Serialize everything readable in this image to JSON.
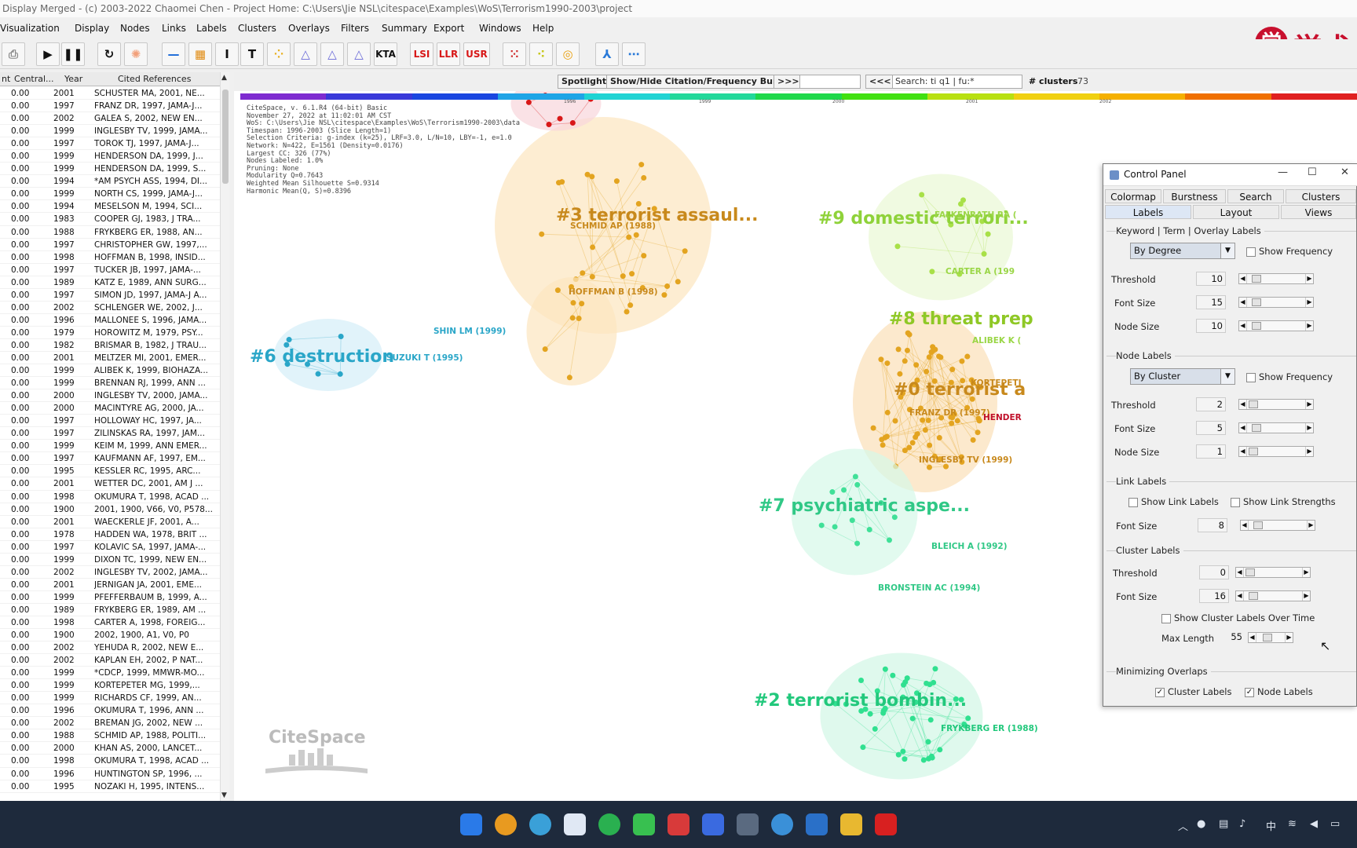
{
  "window": {
    "title": "Display Merged - (c) 2003-2022 Chaomei Chen - Project Home: C:\\Users\\Jie NSL\\citespace\\Examples\\WoS\\Terrorism1990-2003\\project"
  },
  "menu": [
    "Visualization",
    "Display",
    "Nodes",
    "Links",
    "Labels",
    "Clusters",
    "Overlays",
    "Filters",
    "Summary",
    "Export",
    "Windows",
    "Help"
  ],
  "brand": {
    "seal": "学",
    "text": "学术"
  },
  "toolbar": {
    "kta": "KTA",
    "lsi": "LSI",
    "llr": "LLR",
    "usr": "USR"
  },
  "table": {
    "headers": [
      "nt",
      "Central...",
      "Year",
      "Cited References"
    ],
    "rows": [
      [
        "0.00",
        "2001",
        "SCHUSTER MA, 2001, NE..."
      ],
      [
        "0.00",
        "1997",
        "FRANZ DR, 1997, JAMA-J..."
      ],
      [
        "0.00",
        "2002",
        "GALEA S, 2002, NEW EN..."
      ],
      [
        "0.00",
        "1999",
        "INGLESBY TV, 1999, JAMA..."
      ],
      [
        "0.00",
        "1997",
        "TOROK TJ, 1997, JAMA-J..."
      ],
      [
        "0.00",
        "1999",
        "HENDERSON DA, 1999, J..."
      ],
      [
        "0.00",
        "1999",
        "HENDERSON DA, 1999, S..."
      ],
      [
        "0.00",
        "1994",
        "*AM PSYCH ASS, 1994, DI..."
      ],
      [
        "0.00",
        "1999",
        "NORTH CS, 1999, JAMA-J..."
      ],
      [
        "0.00",
        "1994",
        "MESELSON M, 1994, SCI..."
      ],
      [
        "0.00",
        "1983",
        "COOPER GJ, 1983, J TRA..."
      ],
      [
        "0.00",
        "1988",
        "FRYKBERG ER, 1988, AN..."
      ],
      [
        "0.00",
        "1997",
        "CHRISTOPHER GW, 1997,..."
      ],
      [
        "0.00",
        "1998",
        "HOFFMAN B, 1998, INSID..."
      ],
      [
        "0.00",
        "1997",
        "TUCKER JB, 1997, JAMA-..."
      ],
      [
        "0.00",
        "1989",
        "KATZ E, 1989, ANN SURG..."
      ],
      [
        "0.00",
        "1997",
        "SIMON JD, 1997, JAMA-J A..."
      ],
      [
        "0.00",
        "2002",
        "SCHLENGER WE, 2002, J..."
      ],
      [
        "0.00",
        "1996",
        "MALLONEE S, 1996, JAMA..."
      ],
      [
        "0.00",
        "1979",
        "HOROWITZ M, 1979, PSY..."
      ],
      [
        "0.00",
        "1982",
        "BRISMAR B, 1982, J TRAU..."
      ],
      [
        "0.00",
        "2001",
        "MELTZER MI, 2001, EMER..."
      ],
      [
        "0.00",
        "1999",
        "ALIBEK K, 1999, BIOHAZA..."
      ],
      [
        "0.00",
        "1999",
        "BRENNAN RJ, 1999, ANN ..."
      ],
      [
        "0.00",
        "2000",
        "INGLESBY TV, 2000, JAMA..."
      ],
      [
        "0.00",
        "2000",
        "MACINTYRE AG, 2000, JA..."
      ],
      [
        "0.00",
        "1997",
        "HOLLOWAY HC, 1997, JA..."
      ],
      [
        "0.00",
        "1997",
        "ZILINSKAS RA, 1997, JAM..."
      ],
      [
        "0.00",
        "1999",
        "KEIM M, 1999, ANN EMER..."
      ],
      [
        "0.00",
        "1997",
        "KAUFMANN AF, 1997, EM..."
      ],
      [
        "0.00",
        "1995",
        "KESSLER RC, 1995, ARC..."
      ],
      [
        "0.00",
        "2001",
        "WETTER DC, 2001, AM J ..."
      ],
      [
        "0.00",
        "1998",
        "OKUMURA T, 1998, ACAD ..."
      ],
      [
        "0.00",
        "1900",
        "2001, 1900, V66, V0, P578..."
      ],
      [
        "0.00",
        "2001",
        "WAECKERLE JF, 2001, A..."
      ],
      [
        "0.00",
        "1978",
        "HADDEN WA, 1978, BRIT ..."
      ],
      [
        "0.00",
        "1997",
        "KOLAVIC SA, 1997, JAMA-..."
      ],
      [
        "0.00",
        "1999",
        "DIXON TC, 1999, NEW EN..."
      ],
      [
        "0.00",
        "2002",
        "INGLESBY TV, 2002, JAMA..."
      ],
      [
        "0.00",
        "2001",
        "JERNIGAN JA, 2001, EME..."
      ],
      [
        "0.00",
        "1999",
        "PFEFFERBAUM B, 1999, A..."
      ],
      [
        "0.00",
        "1989",
        "FRYKBERG ER, 1989, AM ..."
      ],
      [
        "0.00",
        "1998",
        "CARTER A, 1998, FOREIG..."
      ],
      [
        "0.00",
        "1900",
        "2002, 1900, A1, V0, P0"
      ],
      [
        "0.00",
        "2002",
        "YEHUDA R, 2002, NEW E..."
      ],
      [
        "0.00",
        "2002",
        "KAPLAN EH, 2002, P NAT..."
      ],
      [
        "0.00",
        "1999",
        "*CDCP, 1999, MMWR-MO..."
      ],
      [
        "0.00",
        "1999",
        "KORTEPETER MG, 1999,..."
      ],
      [
        "0.00",
        "1999",
        "RICHARDS CF, 1999, AN..."
      ],
      [
        "0.00",
        "1996",
        "OKUMURA T, 1996, ANN ..."
      ],
      [
        "0.00",
        "2002",
        "BREMAN JG, 2002, NEW ..."
      ],
      [
        "0.00",
        "1988",
        "SCHMID AP, 1988, POLITI..."
      ],
      [
        "0.00",
        "2000",
        "KHAN AS, 2000, LANCET..."
      ],
      [
        "0.00",
        "1998",
        "OKUMURA T, 1998, ACAD ..."
      ],
      [
        "0.00",
        "1996",
        "HUNTINGTON SP, 1996, ..."
      ],
      [
        "0.00",
        "1995",
        "NOZAKI H, 1995, INTENS..."
      ]
    ]
  },
  "vis_toolbar": {
    "spotlight": "Spotlight",
    "burst": "Show/Hide Citation/Frequency Burst",
    "next": ">>>",
    "prev": "<<<",
    "search": "Search: ti q1 | fu:*",
    "clusters_label": "# clusters",
    "clusters_value": "73"
  },
  "timeline": {
    "colors": [
      "#7e2bd0",
      "#3939d9",
      "#1a47e0",
      "#20a4e6",
      "#20d3d3",
      "#22d89a",
      "#1ed84a",
      "#40e010",
      "#b8e010",
      "#f0d010",
      "#f5b000",
      "#f07000",
      "#e02020"
    ],
    "years": [
      "1996",
      "1999",
      "2000",
      "2001",
      "2002"
    ]
  },
  "info_lines": [
    "CiteSpace, v. 6.1.R4 (64-bit) Basic",
    "November 27, 2022 at 11:02:01 AM CST",
    "WoS: C:\\Users\\Jie NSL\\citespace\\Examples\\WoS\\Terrorism1990-2003\\data",
    "Timespan: 1996-2003 (Slice Length=1)",
    "Selection Criteria: g-index (k=25), LRF=3.0, L/N=10, LBY=-1, e=1.0",
    "Network: N=422, E=1561 (Density=0.0176)",
    "Largest CC: 326 (77%)",
    "Nodes Labeled: 1.0%",
    "Pruning: None",
    "Modularity Q=0.7643",
    "Weighted Mean Silhouette S=0.9314",
    "Harmonic Mean(Q, S)=0.8396"
  ],
  "clusters": [
    {
      "label": "#3 terrorist assaul...",
      "color": "#c8891c"
    },
    {
      "label": "#9 domestic terrori...",
      "color": "#8fd23a"
    },
    {
      "label": "#8 threat prep",
      "color": "#8fc826"
    },
    {
      "label": "#0 terrorist a",
      "color": "#c8891c"
    },
    {
      "label": "#6 destruction",
      "color": "#2aa6c8"
    },
    {
      "label": "#7 psychiatric aspe...",
      "color": "#30c886"
    },
    {
      "label": "#2 terrorist bombin...",
      "color": "#22c87c"
    }
  ],
  "node_labels": [
    {
      "label": "SCHMID AP (1988)",
      "color": "#c8891c"
    },
    {
      "label": "HOFFMAN B (1998)",
      "color": "#c8891c"
    },
    {
      "label": "SHIN LM (1999)",
      "color": "#2aa6c8"
    },
    {
      "label": "ISUZUKI T (1995)",
      "color": "#2aa6c8"
    },
    {
      "label": "FALKENRATH RA (",
      "color": "#9ad646"
    },
    {
      "label": "CARTER A (199",
      "color": "#9ad646"
    },
    {
      "label": "ALIBEK K (",
      "color": "#9ad646"
    },
    {
      "label": "KORTEPETI",
      "color": "#c8891c"
    },
    {
      "label": "FRANZ DR (1997)",
      "color": "#c8891c"
    },
    {
      "label": "HENDER",
      "color": "#c0102a"
    },
    {
      "label": "INGLESBY TV (1999)",
      "color": "#c8891c"
    },
    {
      "label": "BLEICH A (1992)",
      "color": "#30c886"
    },
    {
      "label": "BRONSTEIN AC (1994)",
      "color": "#30c886"
    },
    {
      "label": "FRYKBERG ER (1988)",
      "color": "#22c87c"
    }
  ],
  "citespace_logo": "CiteSpace",
  "control_panel": {
    "title": "Control Panel",
    "tabs_top": [
      "Colormap",
      "Burstness",
      "Search",
      "Clusters"
    ],
    "tabs_bottom": [
      "Labels",
      "Layout",
      "Views"
    ],
    "keyword_section": "Keyword | Term | Overlay Labels",
    "keyword_combo": "By Degree",
    "node_section": "Node Labels",
    "node_combo": "By Cluster",
    "show_frequency": "Show Frequency",
    "threshold": "Threshold",
    "font_size": "Font Size",
    "node_size": "Node Size",
    "kw_threshold": "10",
    "kw_font": "15",
    "kw_node": "10",
    "nl_threshold": "2",
    "nl_font": "5",
    "nl_node": "1",
    "link_section": "Link Labels",
    "show_link_labels": "Show Link Labels",
    "show_link_strengths": "Show Link Strengths",
    "link_font": "8",
    "cluster_section": "Cluster Labels",
    "cl_threshold": "0",
    "cl_font": "16",
    "show_cluster_over_time": "Show Cluster Labels Over Time",
    "max_length": "Max Length",
    "max_length_value": "55",
    "min_section": "Minimizing Overlaps",
    "ov_cluster": "Cluster Labels",
    "ov_node": "Node Labels"
  }
}
